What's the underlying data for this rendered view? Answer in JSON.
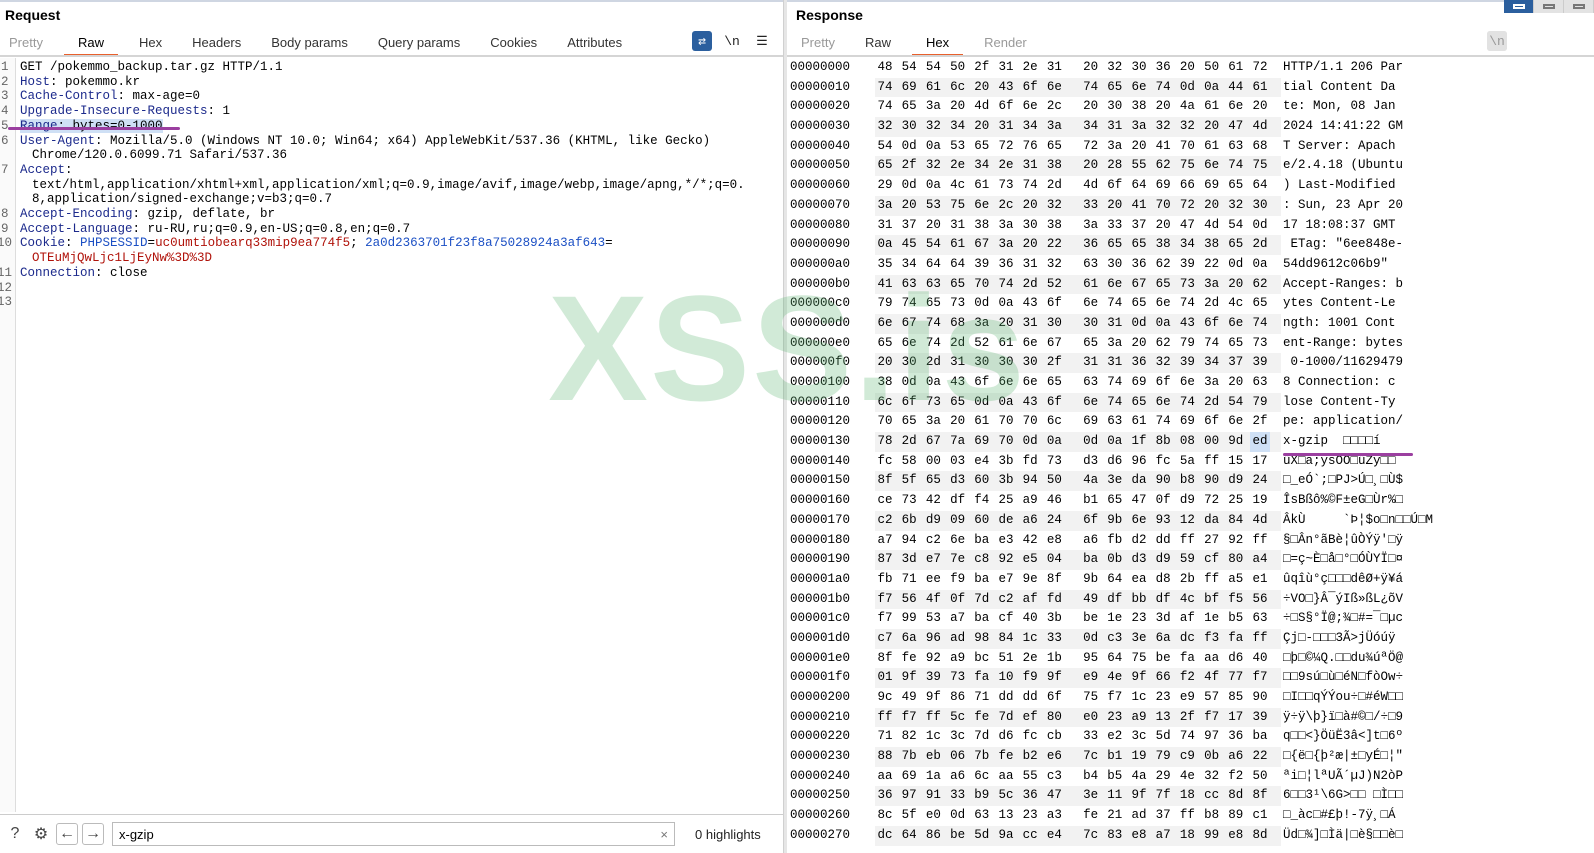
{
  "request": {
    "title": "Request",
    "tabs": [
      {
        "label": "Pretty",
        "state": "dim"
      },
      {
        "label": "Raw",
        "state": "active"
      },
      {
        "label": "Hex"
      },
      {
        "label": "Headers"
      },
      {
        "label": "Body params"
      },
      {
        "label": "Query params"
      },
      {
        "label": "Cookies"
      },
      {
        "label": "Attributes"
      }
    ],
    "tools": {
      "wrap_icon": "wrap-lines-icon",
      "newline_label": "\\n",
      "menu_icon": "hamburger-menu-icon"
    },
    "lines": [
      {
        "num": "1",
        "parts": [
          {
            "t": "GET /pokemmo_backup.tar.gz HTTP/1.1"
          }
        ]
      },
      {
        "num": "2",
        "parts": [
          {
            "t": "Host",
            "c": "hn"
          },
          {
            "t": ": pokemmo.kr"
          }
        ]
      },
      {
        "num": "3",
        "parts": [
          {
            "t": "Cache-Control",
            "c": "hn"
          },
          {
            "t": ": max-age=0"
          }
        ]
      },
      {
        "num": "4",
        "parts": [
          {
            "t": "Upgrade-Insecure-Requests",
            "c": "hn"
          },
          {
            "t": ": 1"
          }
        ]
      },
      {
        "num": "5",
        "highlight": true,
        "parts": [
          {
            "t": "Range",
            "c": "hn"
          },
          {
            "t": ": bytes=0-1000"
          }
        ]
      },
      {
        "num": "6",
        "parts": [
          {
            "t": "User-Agent",
            "c": "hn"
          },
          {
            "t": ": Mozilla/5.0 (Windows NT 10.0; Win64; x64) AppleWebKit/537.36 (KHTML, like Gecko)"
          }
        ]
      },
      {
        "num": "",
        "cont": true,
        "parts": [
          {
            "t": "Chrome/120.0.6099.71 Safari/537.36"
          }
        ]
      },
      {
        "num": "7",
        "parts": [
          {
            "t": "Accept",
            "c": "hn"
          },
          {
            "t": ":"
          }
        ]
      },
      {
        "num": "",
        "cont": true,
        "parts": [
          {
            "t": "text/html,application/xhtml+xml,application/xml;q=0.9,image/avif,image/webp,image/apng,*/*;q=0."
          }
        ]
      },
      {
        "num": "",
        "cont": true,
        "parts": [
          {
            "t": "8,application/signed-exchange;v=b3;q=0.7"
          }
        ]
      },
      {
        "num": "8",
        "parts": [
          {
            "t": "Accept-Encoding",
            "c": "hn"
          },
          {
            "t": ": gzip, deflate, br"
          }
        ]
      },
      {
        "num": "9",
        "parts": [
          {
            "t": "Accept-Language",
            "c": "hn"
          },
          {
            "t": ": ru-RU,ru;q=0.9,en-US;q=0.8,en;q=0.7"
          }
        ]
      },
      {
        "num": "10",
        "parts": [
          {
            "t": "Cookie",
            "c": "hn"
          },
          {
            "t": ": "
          },
          {
            "t": "PHPSESSID",
            "c": "cn"
          },
          {
            "t": "="
          },
          {
            "t": "uc0umtiobearq33mip9ea774f5",
            "c": "cv"
          },
          {
            "t": "; "
          },
          {
            "t": "2a0d2363701f23f8a75028924a3af643",
            "c": "cn"
          },
          {
            "t": "="
          }
        ]
      },
      {
        "num": "",
        "cont": true,
        "parts": [
          {
            "t": "OTEuMjQwLjc1LjEyNw%3D%3D",
            "c": "cv"
          }
        ]
      },
      {
        "num": "11",
        "parts": [
          {
            "t": "Connection",
            "c": "hn"
          },
          {
            "t": ": close"
          }
        ]
      },
      {
        "num": "12",
        "parts": [
          {
            "t": ""
          }
        ]
      },
      {
        "num": "13",
        "parts": [
          {
            "t": ""
          }
        ]
      }
    ],
    "bottom": {
      "help_icon": "help-icon",
      "settings_icon": "gear-icon",
      "back_label": "←",
      "forward_label": "→",
      "search_value": "x-gzip",
      "clear_label": "×",
      "highlights": "0 highlights"
    }
  },
  "watermark": "XSS.is",
  "response": {
    "title": "Response",
    "tabs": [
      {
        "label": "Pretty",
        "state": "dim"
      },
      {
        "label": "Raw"
      },
      {
        "label": "Hex",
        "state": "active"
      },
      {
        "label": "Render",
        "state": "dim"
      }
    ],
    "tools": {
      "wrap_icon": "wrap-lines-icon",
      "newline_label": "\\n",
      "menu_icon": "hamburger-menu-icon"
    },
    "views": [
      "split-horizontal-view",
      "split-vertical-view",
      "tabs-view"
    ],
    "hex_rows": [
      {
        "offset": "00000000",
        "bytes": "48 54 54 50 2f 31 2e 31 20 32 30 36 20 50 61 72",
        "ascii": "HTTP/1.1 206 Par"
      },
      {
        "offset": "00000010",
        "bytes": "74 69 61 6c 20 43 6f 6e 74 65 6e 74 0d 0a 44 61",
        "ascii": "tial Content Da"
      },
      {
        "offset": "00000020",
        "bytes": "74 65 3a 20 4d 6f 6e 2c 20 30 38 20 4a 61 6e 20",
        "ascii": "te: Mon, 08 Jan"
      },
      {
        "offset": "00000030",
        "bytes": "32 30 32 34 20 31 34 3a 34 31 3a 32 32 20 47 4d",
        "ascii": "2024 14:41:22 GM"
      },
      {
        "offset": "00000040",
        "bytes": "54 0d 0a 53 65 72 76 65 72 3a 20 41 70 61 63 68",
        "ascii": "T Server: Apach"
      },
      {
        "offset": "00000050",
        "bytes": "65 2f 32 2e 34 2e 31 38 20 28 55 62 75 6e 74 75",
        "ascii": "e/2.4.18 (Ubuntu"
      },
      {
        "offset": "00000060",
        "bytes": "29 0d 0a 4c 61 73 74 2d 4d 6f 64 69 66 69 65 64",
        "ascii": ") Last-Modified"
      },
      {
        "offset": "00000070",
        "bytes": "3a 20 53 75 6e 2c 20 32 33 20 41 70 72 20 32 30",
        "ascii": ": Sun, 23 Apr 20"
      },
      {
        "offset": "00000080",
        "bytes": "31 37 20 31 38 3a 30 38 3a 33 37 20 47 4d 54 0d",
        "ascii": "17 18:08:37 GMT"
      },
      {
        "offset": "00000090",
        "bytes": "0a 45 54 61 67 3a 20 22 36 65 65 38 34 38 65 2d",
        "ascii": " ETag: \"6ee848e-"
      },
      {
        "offset": "000000a0",
        "bytes": "35 34 64 64 39 36 31 32 63 30 36 62 39 22 0d 0a",
        "ascii": "54dd9612c06b9\""
      },
      {
        "offset": "000000b0",
        "bytes": "41 63 63 65 70 74 2d 52 61 6e 67 65 73 3a 20 62",
        "ascii": "Accept-Ranges: b"
      },
      {
        "offset": "000000c0",
        "bytes": "79 74 65 73 0d 0a 43 6f 6e 74 65 6e 74 2d 4c 65",
        "ascii": "ytes Content-Le"
      },
      {
        "offset": "000000d0",
        "bytes": "6e 67 74 68 3a 20 31 30 30 31 0d 0a 43 6f 6e 74",
        "ascii": "ngth: 1001 Cont"
      },
      {
        "offset": "000000e0",
        "bytes": "65 6e 74 2d 52 61 6e 67 65 3a 20 62 79 74 65 73",
        "ascii": "ent-Range: bytes"
      },
      {
        "offset": "000000f0",
        "bytes": "20 30 2d 31 30 30 30 2f 31 31 36 32 39 34 37 39",
        "ascii": " 0-1000/11629479"
      },
      {
        "offset": "00000100",
        "bytes": "38 0d 0a 43 6f 6e 6e 65 63 74 69 6f 6e 3a 20 63",
        "ascii": "8 Connection: c"
      },
      {
        "offset": "00000110",
        "bytes": "6c 6f 73 65 0d 0a 43 6f 6e 74 65 6e 74 2d 54 79",
        "ascii": "lose Content-Ty"
      },
      {
        "offset": "00000120",
        "bytes": "70 65 3a 20 61 70 70 6c 69 63 61 74 69 6f 6e 2f",
        "ascii": "pe: application/"
      },
      {
        "offset": "00000130",
        "bytes": "78 2d 67 7a 69 70 0d 0a 0d 0a 1f 8b 08 00 9d ed",
        "ascii": "x-gzip  □□□□í",
        "selected_byte": 15
      },
      {
        "offset": "00000140",
        "bytes": "fc 58 00 03 e4 3b fd 73 d3 d6 96 fc 5a ff 15 17",
        "ascii": "üX□a;ysÓÖ□üZÿ□□"
      },
      {
        "offset": "00000150",
        "bytes": "8f 5f 65 d3 60 3b 94 50 4a 3e da 90 b8 90 d9 24",
        "ascii": "□_eÓ`;□PJ>Ú□¸□Ù$"
      },
      {
        "offset": "00000160",
        "bytes": "ce 73 42 df f4 25 a9 46 b1 65 47 0f d9 72 25 19",
        "ascii": "ÎsBßô%©F±eG□Ùr%□"
      },
      {
        "offset": "00000170",
        "bytes": "c2 6b d9 09 60 de a6 24 6f 9b 6e 93 12 da 84 4d",
        "ascii": "ÂkÙ     `Þ¦$o□n□□Ú□M"
      },
      {
        "offset": "00000180",
        "bytes": "a7 94 c2 6e ba e3 42 e8 a6 fb d2 dd ff 27 92 ff",
        "ascii": "§□Ân°ãBè¦ûÒÝÿ'□ÿ"
      },
      {
        "offset": "00000190",
        "bytes": "87 3d e7 7e c8 92 e5 04 ba 0b d3 d9 59 cf 80 a4",
        "ascii": "□=ç~È□å□°□ÓÙYÏ□¤"
      },
      {
        "offset": "000001a0",
        "bytes": "fb 71 ee f9 ba e7 9e 8f 9b 64 ea d8 2b ff a5 e1",
        "ascii": "ûqîù°ç□□□dêØ+ÿ¥á"
      },
      {
        "offset": "000001b0",
        "bytes": "f7 56 4f 0f 7d c2 af fd 49 df bb df 4c bf f5 56",
        "ascii": "÷VO□}Â¯ýIß»ßL¿õV"
      },
      {
        "offset": "000001c0",
        "bytes": "f7 99 53 a7 ba cf 40 3b be 1e 23 3d af 1e b5 63",
        "ascii": "÷□S§°Ï@;¾□#=¯□µc"
      },
      {
        "offset": "000001d0",
        "bytes": "c7 6a 96 ad 98 84 1c 33 0d c3 3e 6a dc f3 fa ff",
        "ascii": "Çj□-□□□3Ã>jÜóúÿ"
      },
      {
        "offset": "000001e0",
        "bytes": "8f fe 92 a9 bc 51 2e 1b 95 64 75 be fa aa d6 40",
        "ascii": "□þ□©¼Q.□□du¾úªÖ@"
      },
      {
        "offset": "000001f0",
        "bytes": "01 9f 39 73 fa 10 f9 9f e9 4e 9f 66 f2 4f 77 f7",
        "ascii": "□□9sú□ù□éN□fòOw÷"
      },
      {
        "offset": "00000200",
        "bytes": "9c 49 9f 86 71 dd dd 6f 75 f7 1c 23 e9 57 85 90",
        "ascii": "□I□□qÝÝou÷□#éW□□"
      },
      {
        "offset": "00000210",
        "bytes": "ff f7 ff 5c fe 7d ef 80 e0 23 a9 13 2f f7 17 39",
        "ascii": "ÿ÷ÿ\\þ}ï□à#©□/÷□9"
      },
      {
        "offset": "00000220",
        "bytes": "71 82 1c 3c 7d d6 fc cb 33 e2 3c 5d 74 97 36 ba",
        "ascii": "q□□<}ÖüË3â<]t□6º"
      },
      {
        "offset": "00000230",
        "bytes": "88 7b eb 06 7b fe b2 e6 7c b1 19 79 c9 0b a6 22",
        "ascii": "□{ë□{þ²æ|±□yÉ□¦\""
      },
      {
        "offset": "00000240",
        "bytes": "aa 69 1a a6 6c aa 55 c3 b4 b5 4a 29 4e 32 f2 50",
        "ascii": "ªi□¦lªUÃ´µJ)N2òP"
      },
      {
        "offset": "00000250",
        "bytes": "36 97 91 33 b9 5c 36 47 3e 11 9f 7f 18 cc 8d 8f",
        "ascii": "6□□3¹\\6G>□□ □Ì□□"
      },
      {
        "offset": "00000260",
        "bytes": "8c 5f e0 0d 63 13 23 a3 fe 21 ad 37 ff b8 89 c1",
        "ascii": "□_àc□#£þ!-7ÿ¸□Á"
      },
      {
        "offset": "00000270",
        "bytes": "dc 64 86 be 5d 9a cc e4 7c 83 e8 a7 18 99 e8 8d",
        "ascii": "Üd□¾]□Ìä|□è§□□è□"
      }
    ]
  },
  "colors": {
    "accent_tab": "#e8602c",
    "active_tool": "#2b5f9e",
    "annotation": "#9b3fa0",
    "selection": "#cfe0f5",
    "watermark": "#5ab46e"
  }
}
